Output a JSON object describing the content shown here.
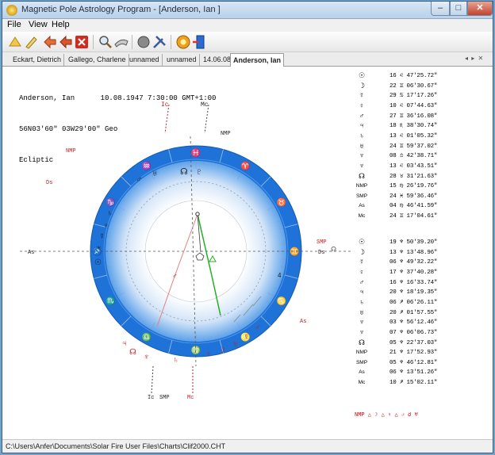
{
  "window": {
    "title": "Magnetic Pole Astrology Program - [Anderson, Ian ]",
    "min": "–",
    "max": "□",
    "close": "✕"
  },
  "menu": [
    "File",
    "View",
    "Help"
  ],
  "toolbar": {
    "icons": [
      "open-chart-icon",
      "edit-chart-icon",
      "new-chart-icon",
      "save-chart-icon",
      "close-chart-icon",
      "search-icon",
      "link-icon",
      "settings-icon",
      "tools-icon",
      "help-icon",
      "exit-icon"
    ]
  },
  "tabs": [
    "Eckart, Dietrich",
    "Gallego, Charlene",
    "unnamed",
    "unnamed",
    "14.06.08",
    "Anderson, Ian"
  ],
  "tabs_active": 5,
  "tab_scroll": "◂ ▸ ✕",
  "chart_header": {
    "line1": "Anderson, Ian      10.08.1947 7:30:00 GMT+1:00",
    "line2": "56N03'60\" 03W29'00\" Geo",
    "line3": "Ecliptic"
  },
  "wheel": {
    "labels": {
      "ic_top": "Ic",
      "mc_top": "Mc",
      "nmp_top": "NMP",
      "nmp_left": "NMP",
      "ds_left": "Ds",
      "as_left": "As",
      "smp_right": "SMP",
      "ds_right": "Ds",
      "as_right": "As",
      "ic_bottom": "Ic",
      "smp_bottom": "SMP",
      "mc_bottom": "Mc",
      "right_glyph": "☊",
      "num_4": "4"
    },
    "zodiac": [
      "♈",
      "♉",
      "♊",
      "♋",
      "♌",
      "♍",
      "♎",
      "♏",
      "♐",
      "♑",
      "♒",
      "♓"
    ],
    "inner_planets_top": [
      "♂",
      "♅",
      "☊",
      "♇"
    ],
    "inner_planets_left": [
      "♄",
      "♀",
      "☿",
      "♆",
      "☉"
    ],
    "inner_planets_bottom": [
      "♃",
      "☊",
      "♆",
      "♄",
      "♀",
      "☽",
      "♅",
      "☿",
      "♂"
    ],
    "colors": {
      "ring": "#1e72d8",
      "ring_light": "#3a8ee6",
      "accent_red": "#d02020",
      "green": "#23b023"
    }
  },
  "planet_list_1": [
    {
      "g": "☉",
      "v": "16 ♌ 47'25.72\""
    },
    {
      "g": "☽",
      "v": "22 ♊ 06'30.67\""
    },
    {
      "g": "☿",
      "v": "29 ♋ 17'17.26\""
    },
    {
      "g": "♀",
      "v": "10 ♌ 07'44.63\""
    },
    {
      "g": "♂",
      "v": "27 ♊ 36'16.08\""
    },
    {
      "g": "♃",
      "v": "18 ♏ 38'30.74\""
    },
    {
      "g": "♄",
      "v": "13 ♌ 01'05.32\""
    },
    {
      "g": "♅",
      "v": "24 ♊ 59'37.02\""
    },
    {
      "g": "♆",
      "v": "08 ♎ 42'38.71\""
    },
    {
      "g": "♆",
      "v": "13 ♌ 03'43.51\""
    },
    {
      "g": "☊",
      "v": "28 ♉ 31'21.63\""
    },
    {
      "g": "NMP",
      "v": "15 ♍ 26'19.76\""
    },
    {
      "g": "SMP",
      "v": "24 ♓ 59'36.46\""
    },
    {
      "g": "As",
      "v": "04 ♍ 46'41.59\""
    },
    {
      "g": "Mc",
      "v": "24 ♊ 17'04.61\""
    }
  ],
  "planet_list_2": [
    {
      "g": "☉",
      "v": "19 ♆ 50'39.20\""
    },
    {
      "g": "☽",
      "v": "13 ♆ 13'48.96\""
    },
    {
      "g": "☿",
      "v": "06 ♆ 49'32.22\""
    },
    {
      "g": "♀",
      "v": "17 ♆ 37'40.28\""
    },
    {
      "g": "♂",
      "v": "16 ♆ 16'33.74\""
    },
    {
      "g": "♃",
      "v": "20 ♆ 18'19.35\""
    },
    {
      "g": "♄",
      "v": "06 ♐ 06'26.11\""
    },
    {
      "g": "♅",
      "v": "20 ♐ 01'57.55\""
    },
    {
      "g": "♆",
      "v": "03 ♆ 56'12.46\""
    },
    {
      "g": "♆",
      "v": "07 ♆ 06'06.73\""
    },
    {
      "g": "☊",
      "v": "05 ♆ 22'37.03\""
    },
    {
      "g": "NMP",
      "v": "21 ♆ 17'52.93\""
    },
    {
      "g": "SMP",
      "v": "05 ♆ 46'12.81\""
    },
    {
      "g": "As",
      "v": "06 ♆ 13'51.26\""
    },
    {
      "g": "Mc",
      "v": "10 ♐ 15'02.11\""
    }
  ],
  "aspect_row": "NMP       △ ☽     △ ♀     △ ♂   ☌ ♅",
  "status": "C:\\Users\\Anfer\\Documents\\Solar Fire User Files\\Charts\\Clif2000.CHT"
}
